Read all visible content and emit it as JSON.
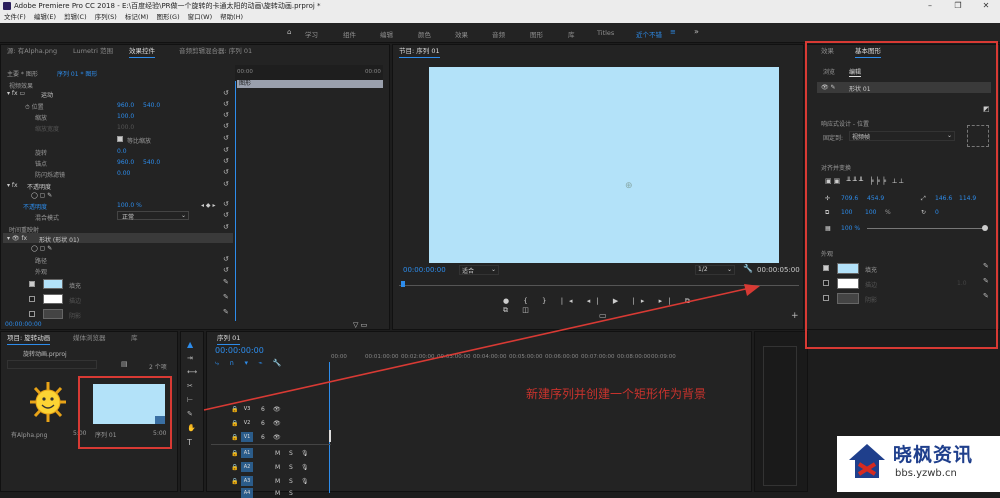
{
  "window": {
    "title": "Adobe Premiere Pro CC 2018 - E:\\百度经验\\PR做一个旋转的卡通太阳的动画\\旋转动画.prproj *"
  },
  "menu": [
    "文件(F)",
    "编辑(E)",
    "剪辑(C)",
    "序列(S)",
    "标记(M)",
    "图形(G)",
    "窗口(W)",
    "帮助(H)"
  ],
  "workspaces": [
    "学习",
    "组件",
    "编辑",
    "颜色",
    "效果",
    "音频",
    "图形",
    "库",
    "Titles",
    "近个不错"
  ],
  "source_panel": {
    "tabs": [
      "源: 有Alpha.png",
      "Lumetri 范围",
      "效果控件",
      "音频剪辑混合器: 序列 01"
    ],
    "master": "主要 * 图形",
    "seq": "序列 01 * 图形",
    "timeline_label": "图形",
    "ruler": [
      "00:00",
      "00:00"
    ],
    "video_effects": "视频效果",
    "motion": "运动",
    "position": "位置",
    "pos_x": "960.0",
    "pos_y": "540.0",
    "scale": "缩放",
    "scale_val": "100.0",
    "scale_width": "缩放宽度",
    "scale_width_val": "100.0",
    "uniform": "等比缩放",
    "rotation": "旋转",
    "rotation_val": "0.0",
    "anchor": "锚点",
    "anchor_x": "960.0",
    "anchor_y": "540.0",
    "flicker": "防闪烁滤镜",
    "flicker_val": "0.00",
    "opacity": "不透明度",
    "opacity_sub": "不透明度",
    "opacity_val": "100.0 %",
    "blend": "混合模式",
    "blend_val": "正常",
    "time_remap": "时间重映射",
    "shape": "形状 (形状 01)",
    "path": "路径",
    "appearance": "外观",
    "fill": "填充",
    "stroke": "描边",
    "shadow": "阴影",
    "timecode": "00:00:00:00"
  },
  "program": {
    "title": "节目: 序列 01",
    "tc_left": "00:00:00:00",
    "fit": "适合",
    "res": "1/2",
    "tc_right": "00:00:05:00"
  },
  "right": {
    "tabs": [
      "效果",
      "基本图形"
    ],
    "subtabs": [
      "浏览",
      "编辑"
    ],
    "layer": "形状 01",
    "responsive": "响应式设计 - 位置",
    "fixed": "固定到:",
    "fixed_val": "视频帧",
    "align": "对齐并变换",
    "px": "709.6",
    "py": "454.9",
    "w": "146.6",
    "h": "114.9",
    "s1": "100",
    "s2": "100",
    "pct": "%",
    "rot": "0",
    "op": "100 %",
    "appearance": "外观",
    "fill": "填充",
    "stroke": "描边",
    "shadow": "阴影",
    "stroke_val": "1.0"
  },
  "project": {
    "tabs": [
      "项目: 旋转动画",
      "媒体浏览器",
      "库"
    ],
    "file": "旋转动画.prproj",
    "count": "2 个项",
    "item1": "有Alpha.png",
    "item1_dur": "5:00",
    "item2": "序列 01",
    "item2_dur": "5:00"
  },
  "timeline": {
    "tab": "序列 01",
    "tc": "00:00:00:00",
    "ruler": [
      "00:00",
      "00:01:00:00",
      "00:02:00:00",
      "00:03:00:00",
      "00:04:00:00",
      "00:05:00:00",
      "00:06:00:00",
      "00:07:00:00",
      "00:08:00:00",
      "00:09:00"
    ],
    "tracks": [
      "V3",
      "V2",
      "V1",
      "A1",
      "A2",
      "A3",
      "A4"
    ],
    "track_labels": [
      "6",
      "6",
      "6",
      "M",
      "M",
      "M",
      "M"
    ],
    "track_s": [
      "S",
      "S",
      "S",
      "S"
    ]
  },
  "annotation": "新建序列并创建一个矩形作为背景",
  "watermark": {
    "name": "晓枫资讯",
    "url": "bbs.yzwb.cn"
  },
  "colors": {
    "accent": "#2d8ceb",
    "annotation": "#d83a34",
    "canvas": "#b3e2f9"
  }
}
